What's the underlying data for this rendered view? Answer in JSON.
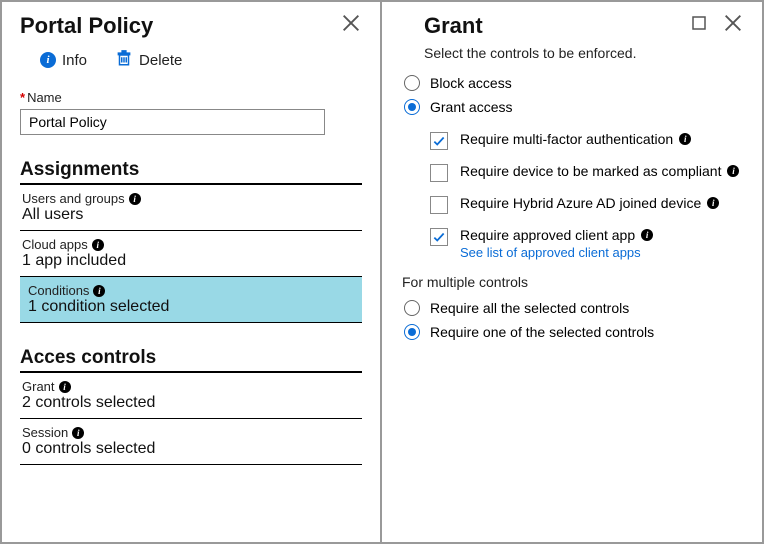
{
  "left": {
    "title": "Portal Policy",
    "toolbar": {
      "info": "Info",
      "delete": "Delete"
    },
    "nameField": {
      "label": "Name",
      "value": "Portal Policy"
    },
    "sections": {
      "assignments": {
        "title": "Assignments",
        "usersGroups": {
          "label": "Users and groups",
          "value": "All users"
        },
        "cloudApps": {
          "label": "Cloud apps",
          "value": "1 app included"
        },
        "conditions": {
          "label": "Conditions",
          "value": "1 condition selected"
        }
      },
      "access": {
        "title": "Acces controls",
        "grant": {
          "label": "Grant",
          "value": "2 controls selected"
        },
        "session": {
          "label": "Session",
          "value": "0 controls selected"
        }
      }
    }
  },
  "right": {
    "title": "Grant",
    "subtitle": "Select the controls to be enforced.",
    "accessRadios": {
      "block": "Block access",
      "grant": "Grant access"
    },
    "checks": {
      "mfa": "Require multi-factor authentication",
      "compliant": "Require device to be marked as compliant",
      "hybrid": "Require Hybrid Azure AD joined device",
      "approved": "Require approved client app",
      "approvedLink": "See list of approved client apps"
    },
    "multi": {
      "label": "For multiple controls",
      "all": "Require all the selected controls",
      "one": "Require one of the selected controls"
    }
  }
}
